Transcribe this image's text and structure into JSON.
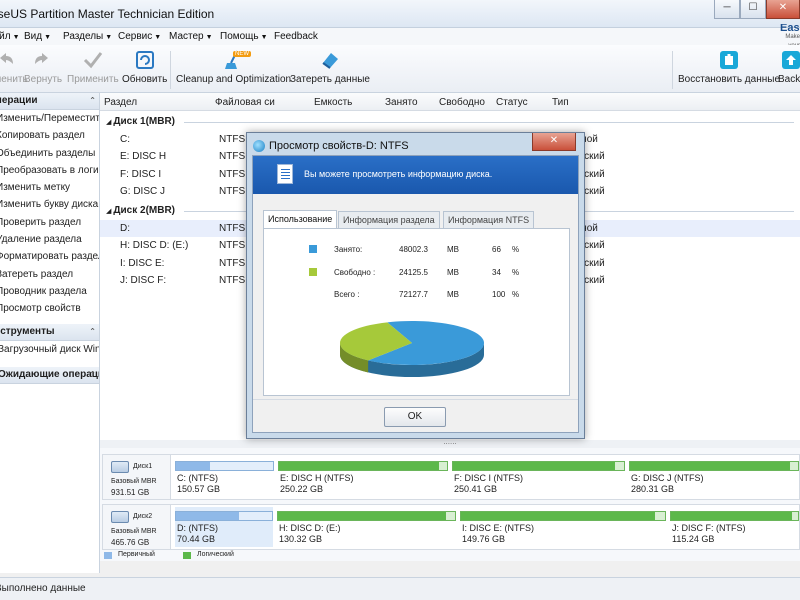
{
  "window": {
    "title": "EaseUS Partition Master Technician Edition",
    "min": "─",
    "max": "☐",
    "close": "✕"
  },
  "menu": [
    {
      "label": "Файл"
    },
    {
      "label": "Вид"
    },
    {
      "label": "Разделы"
    },
    {
      "label": "Сервис"
    },
    {
      "label": "Мастер"
    },
    {
      "label": "Помощь"
    },
    {
      "label": "Feedback"
    }
  ],
  "brand": {
    "name": "EaseUS",
    "tagline": "Make your life easy!"
  },
  "toolbar": {
    "undo": "Отменить",
    "redo": "Вернуть",
    "apply": "Применить",
    "refresh": "Обновить",
    "cleanup": "Cleanup and Optimization",
    "new_badge": "NEW",
    "wipe": "Затереть данные",
    "restore": "Восстановить данные",
    "backup": "Backup"
  },
  "left_panel": {
    "operations_title": "Операции",
    "operations": [
      "Изменить/Переместить раздел",
      "Копировать раздел",
      "Объединить разделы",
      "Преобразовать в логический",
      "Изменить метку",
      "Изменить букву диска",
      "Проверить раздел",
      "Удаление раздела",
      "Форматировать раздел",
      "Затереть раздел",
      "Проводник раздела",
      "Просмотр свойств"
    ],
    "tools_title": "Инструменты",
    "tools": [
      "Загрузочный диск Windows PE"
    ],
    "pending_title": "Ожидающие операции"
  },
  "table": {
    "columns": [
      "Раздел",
      "Файловая си",
      "Емкость",
      "Занято",
      "Свободно",
      "Статус",
      "Тип"
    ],
    "disk1": "Диск 1(MBR)",
    "disk2": "Диск 2(MBR)",
    "rows1": [
      {
        "name": "C:",
        "fs": "NTFS",
        "type": "Основной"
      },
      {
        "name": "E: DISC H",
        "fs": "NTFS",
        "type": "Логический"
      },
      {
        "name": "F: DISC I",
        "fs": "NTFS",
        "type": "Логический"
      },
      {
        "name": "G: DISC J",
        "fs": "NTFS",
        "type": "Логический"
      }
    ],
    "rows2": [
      {
        "name": "D:",
        "fs": "NTFS",
        "type": "Основной"
      },
      {
        "name": "H: DISC D: (E:)",
        "fs": "NTFS",
        "type": "Логический"
      },
      {
        "name": "I: DISC E:",
        "fs": "NTFS",
        "type": "Логический"
      },
      {
        "name": "J: DISC F:",
        "fs": "NTFS",
        "type": "Логический"
      }
    ]
  },
  "diskmap": {
    "disk1": {
      "name": "Диск1",
      "type": "Базовый MBR",
      "size": "931.51 GB",
      "parts": [
        {
          "label": "C: (NTFS)",
          "size": "150.57 GB",
          "kind": "primary",
          "used": 0.35
        },
        {
          "label": "E: DISC H (NTFS)",
          "size": "250.22 GB",
          "kind": "logical",
          "used": 0.95
        },
        {
          "label": "F: DISC I (NTFS)",
          "size": "250.41 GB",
          "kind": "logical",
          "used": 0.95
        },
        {
          "label": "G: DISC J (NTFS)",
          "size": "280.31 GB",
          "kind": "logical",
          "used": 0.95
        }
      ]
    },
    "disk2": {
      "name": "Диск2",
      "type": "Базовый MBR",
      "size": "465.76 GB",
      "parts": [
        {
          "label": "D: (NTFS)",
          "size": "70.44 GB",
          "kind": "primary",
          "used": 0.66
        },
        {
          "label": "H: DISC D: (E:)",
          "size": "130.32 GB",
          "kind": "logical",
          "used": 0.95
        },
        {
          "label": "I: DISC E: (NTFS)",
          "size": "149.76 GB",
          "kind": "logical",
          "used": 0.95
        },
        {
          "label": "J: DISC F: (NTFS)",
          "size": "115.24 GB",
          "kind": "logical",
          "used": 0.95
        }
      ]
    },
    "legend_primary": "Первичный",
    "legend_logical": "Логический",
    "primary_color": "#8fb9e8",
    "logical_color": "#5cb84a"
  },
  "status": "Выполнено данные",
  "dialog": {
    "title": "Просмотр свойств-D: NTFS",
    "banner": "Вы можете просмотреть информацию диска.",
    "tabs": [
      "Использование",
      "Информация раздела",
      "Информация NTFS"
    ],
    "used_label": "Занято:",
    "used_value": "48002.3",
    "used_unit": "MB",
    "used_pct": "66",
    "pct_sign": "%",
    "free_label": "Свободно :",
    "free_value": "24125.5",
    "free_unit": "MB",
    "free_pct": "34",
    "total_label": "Всего :",
    "total_value": "72127.7",
    "total_unit": "MB",
    "total_pct": "100",
    "used_color": "#3a9ad9",
    "free_color": "#a6c93a",
    "ok": "OK"
  }
}
